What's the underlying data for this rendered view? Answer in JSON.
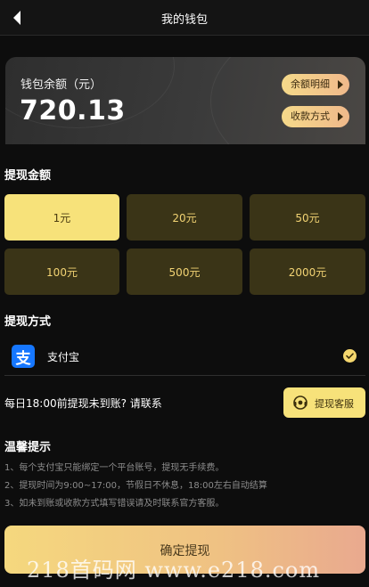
{
  "header": {
    "title": "我的钱包",
    "back_icon": "back-arrow-icon"
  },
  "balance": {
    "label": "钱包余额（元）",
    "amount": "720.13",
    "detail_button": "余额明细",
    "method_button": "收款方式"
  },
  "withdraw_amount": {
    "title": "提现金额",
    "options": [
      "1元",
      "20元",
      "50元",
      "100元",
      "500元",
      "2000元"
    ],
    "selected_index": 0
  },
  "withdraw_method": {
    "title": "提现方式",
    "method_label": "支付宝",
    "method_icon_glyph": "支",
    "checked": true
  },
  "notice": {
    "text": "每日18:00前提现未到账? 请联系",
    "service_button": "提现客服"
  },
  "tips": {
    "title": "温馨提示",
    "items": [
      "1、每个支付宝只能绑定一个平台账号，提现无手续费。",
      "2、提现时间为9:00~17:00，节假日不休息，18:00左右自动结算",
      "3、如未到账或收款方式填写错误请及时联系官方客服。"
    ]
  },
  "confirm_button": "确定提现",
  "watermark": "218首码网  www.e218.com",
  "colors": {
    "background": "#0d0d0d",
    "accent_yellow": "#f7e27a",
    "cell_dark": "#3a3417",
    "alipay_blue": "#1677ff"
  }
}
